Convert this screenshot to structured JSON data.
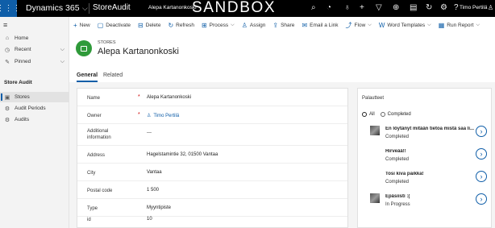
{
  "topbar": {
    "brand": "Dynamics 365",
    "app": "StoreAudit",
    "record": "Alepa Kartanonkoski",
    "env": "SANDBOX",
    "user": "Timo Pertilä",
    "icons": [
      "search-icon",
      "recent-icon",
      "lightbulb-icon",
      "new-icon",
      "filter-icon",
      "settings-gear-icon",
      "phone-icon",
      "flow-icon",
      "gear-icon",
      "help-icon",
      "user-icon"
    ]
  },
  "commands": [
    {
      "label": "New",
      "icon": "plus-icon"
    },
    {
      "label": "Deactivate",
      "icon": "deactivate-icon"
    },
    {
      "label": "Delete",
      "icon": "delete-icon"
    },
    {
      "label": "Refresh",
      "icon": "refresh-icon"
    },
    {
      "label": "Process",
      "icon": "process-icon",
      "dropdown": true
    },
    {
      "label": "Assign",
      "icon": "assign-icon"
    },
    {
      "label": "Share",
      "icon": "share-icon"
    },
    {
      "label": "Email a Link",
      "icon": "email-icon"
    },
    {
      "label": "Flow",
      "icon": "flow-icon",
      "dropdown": true
    },
    {
      "label": "Word Templates",
      "icon": "word-icon",
      "dropdown": true
    },
    {
      "label": "Run Report",
      "icon": "report-icon",
      "dropdown": true
    }
  ],
  "sidebar": {
    "home": "Home",
    "recent": "Recent",
    "pinned": "Pinned",
    "group": "Store Audit",
    "stores": "Stores",
    "audit_periods": "Audit Periods",
    "audits": "Audits"
  },
  "header": {
    "entity": "STORES",
    "name": "Alepa Kartanonkoski"
  },
  "tabs": {
    "general": "General",
    "related": "Related"
  },
  "fields": {
    "name": {
      "label": "Name",
      "value": "Alepa Kartanonkoski"
    },
    "owner": {
      "label": "Owner",
      "value": "Timo Pertilä"
    },
    "additional": {
      "label1": "Additional",
      "label2": "information",
      "value": "---"
    },
    "address": {
      "label": "Address",
      "value": "Hagelstamintie 32, 01500 Vantaa"
    },
    "city": {
      "label": "City",
      "value": "Vantaa"
    },
    "postal": {
      "label": "Postal code",
      "value": "1 500"
    },
    "type": {
      "label": "Type",
      "value": "Myyntipiste"
    },
    "id": {
      "label": "id",
      "value": "10"
    }
  },
  "panel": {
    "title": "Palautteet",
    "filter_all": "All",
    "filter_completed": "Completed",
    "items": [
      {
        "title": "En löytänyt mitään tietoa mistä saa li...",
        "status": "Completed"
      },
      {
        "title": "Hirveää!!",
        "status": "Completed"
      },
      {
        "title": "Tosi kiva paikka!",
        "status": "Completed"
      },
      {
        "title": "Epäsiisti :(",
        "status": "In Progress"
      }
    ]
  },
  "colors": {
    "accent": "#0f5ea8",
    "store_icon": "#2f9a3a",
    "required": "#cc0000"
  }
}
